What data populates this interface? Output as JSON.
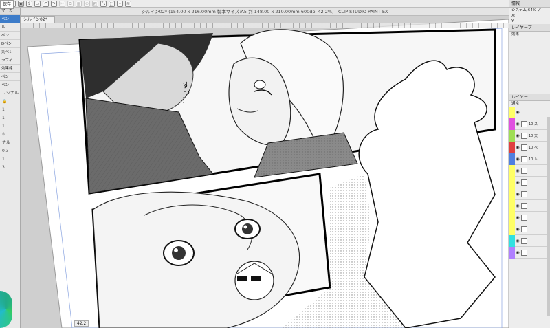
{
  "window": {
    "title": "シルイン02* (154.00 x 216.00mm 製本サイズ:A5 判 148.00 x 210.00mm 600dpi 42.2%) - CLIP STUDIO PAINT EX"
  },
  "tabs": {
    "file_tab": "シルイン02*"
  },
  "toolbar": {
    "save_tooltip": "保存"
  },
  "left_panel": {
    "tab": "マーカー",
    "tools": [
      "ペン",
      "ル",
      "ペン",
      "Dペン",
      "丸ペン",
      "ラフィ",
      "効果線",
      "ペン",
      "ペン"
    ],
    "subtool_header": "リジナル",
    "brush_sizes": [
      "0.3",
      "1",
      "3"
    ],
    "bottom": "ナル",
    "values": [
      "1",
      "1",
      "1"
    ]
  },
  "canvas": {
    "vertical_text": "すっ…"
  },
  "status_bar": {
    "zoom": "42.2"
  },
  "right_panel": {
    "nav_tab": "情報",
    "nav_label": "システム",
    "nav_value": "システム:64% ア",
    "nav_x": "X:",
    "nav_y": "Y:",
    "layer_prop": "レイヤープ",
    "effect": "効果",
    "layers_header": "レイヤー",
    "blend": "通常",
    "layers": [
      {
        "color": "#ffff66",
        "name": "",
        "thumb": false
      },
      {
        "color": "#e050e0",
        "name": "10 ス",
        "thumb": true
      },
      {
        "color": "#9fde55",
        "name": "10 文",
        "thumb": true
      },
      {
        "color": "#e04040",
        "name": "10 ペ",
        "thumb": true
      },
      {
        "color": "#5080e0",
        "name": "10 ト",
        "thumb": true
      },
      {
        "color": "#ffff66",
        "name": "",
        "thumb": true
      },
      {
        "color": "#ffff66",
        "name": "",
        "thumb": true
      },
      {
        "color": "#ffff66",
        "name": "",
        "thumb": true
      },
      {
        "color": "#ffff66",
        "name": "",
        "thumb": true
      },
      {
        "color": "#ffff66",
        "name": "",
        "thumb": true
      },
      {
        "color": "#ffff66",
        "name": "",
        "thumb": true
      },
      {
        "color": "#33e0e0",
        "name": "",
        "thumb": true
      },
      {
        "color": "#b080ff",
        "name": "",
        "thumb": true
      }
    ]
  }
}
